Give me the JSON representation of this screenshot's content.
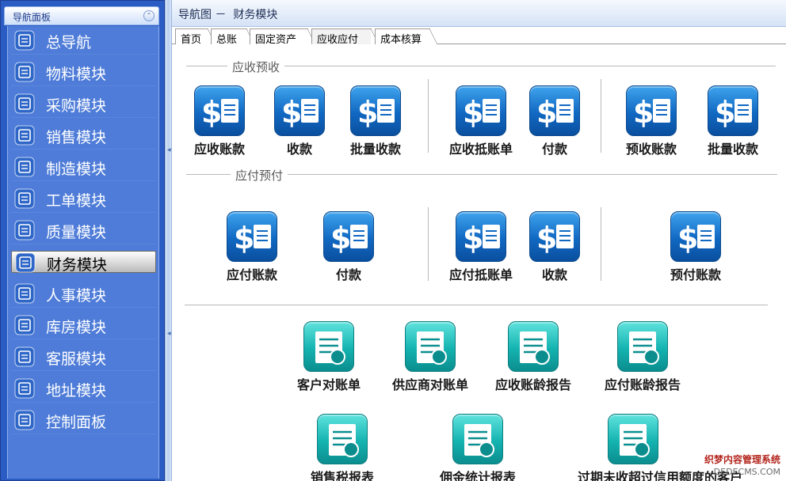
{
  "nav": {
    "title": "导航面板",
    "collapse_glyph": "⌃",
    "items": [
      {
        "label": "总导航",
        "icon": "home-icon"
      },
      {
        "label": "物料模块",
        "icon": "material-icon"
      },
      {
        "label": "采购模块",
        "icon": "cart-icon"
      },
      {
        "label": "销售模块",
        "icon": "truck-icon"
      },
      {
        "label": "制造模块",
        "icon": "factory-icon"
      },
      {
        "label": "工单模块",
        "icon": "workorder-icon"
      },
      {
        "label": "质量模块",
        "icon": "quality-icon"
      },
      {
        "label": "财务模块",
        "icon": "finance-icon",
        "active": true
      },
      {
        "label": "人事模块",
        "icon": "personnel-icon"
      },
      {
        "label": "库房模块",
        "icon": "warehouse-icon"
      },
      {
        "label": "客服模块",
        "icon": "service-icon"
      },
      {
        "label": "地址模块",
        "icon": "address-icon"
      },
      {
        "label": "控制面板",
        "icon": "control-panel-icon"
      }
    ]
  },
  "header": {
    "breadcrumb": "导航图 －  财务模块"
  },
  "tabs": [
    {
      "label": "首页"
    },
    {
      "label": "总账"
    },
    {
      "label": "固定资产"
    },
    {
      "label": "应收应付",
      "active": true
    },
    {
      "label": "成本核算"
    }
  ],
  "sections": {
    "receivable": {
      "title": "应收预收",
      "items": [
        {
          "label": "应收账款",
          "icon": "receivable-account-icon"
        },
        {
          "label": "收款",
          "icon": "receipt-icon"
        },
        {
          "label": "批量收款",
          "icon": "batch-receipt-icon"
        },
        {
          "label": "应收抵账单",
          "icon": "receivable-offset-icon"
        },
        {
          "label": "付款",
          "icon": "payment-icon"
        },
        {
          "label": "预收账款",
          "icon": "advance-receipt-icon"
        },
        {
          "label": "批量收款",
          "icon": "batch-receipt-icon"
        }
      ]
    },
    "payable": {
      "title": "应付预付",
      "items": [
        {
          "label": "应付账款",
          "icon": "payable-account-icon"
        },
        {
          "label": "付款",
          "icon": "payment-icon"
        },
        {
          "label": "应付抵账单",
          "icon": "payable-offset-icon"
        },
        {
          "label": "收款",
          "icon": "receipt-icon"
        },
        {
          "label": "预付账款",
          "icon": "advance-payment-icon"
        }
      ]
    },
    "reports": {
      "items": [
        {
          "label": "客户对账单",
          "icon": "customer-statement-icon"
        },
        {
          "label": "供应商对账单",
          "icon": "supplier-statement-icon"
        },
        {
          "label": "应收账龄报告",
          "icon": "receivable-aging-icon"
        },
        {
          "label": "应付账龄报告",
          "icon": "payable-aging-icon"
        },
        {
          "label": "销售税报表",
          "icon": "sales-tax-icon"
        },
        {
          "label": "佣金统计报表",
          "icon": "commission-icon"
        },
        {
          "label": "过期未收超过信用额度的客户",
          "icon": "overdue-customer-icon"
        }
      ]
    }
  },
  "watermark": {
    "line1": "织梦内容管理系统",
    "line2": "DEDECMS.COM"
  },
  "colors": {
    "nav_bg": "#4e7cd8",
    "icon_blue": "#1168c2",
    "icon_teal": "#14b3b0"
  }
}
